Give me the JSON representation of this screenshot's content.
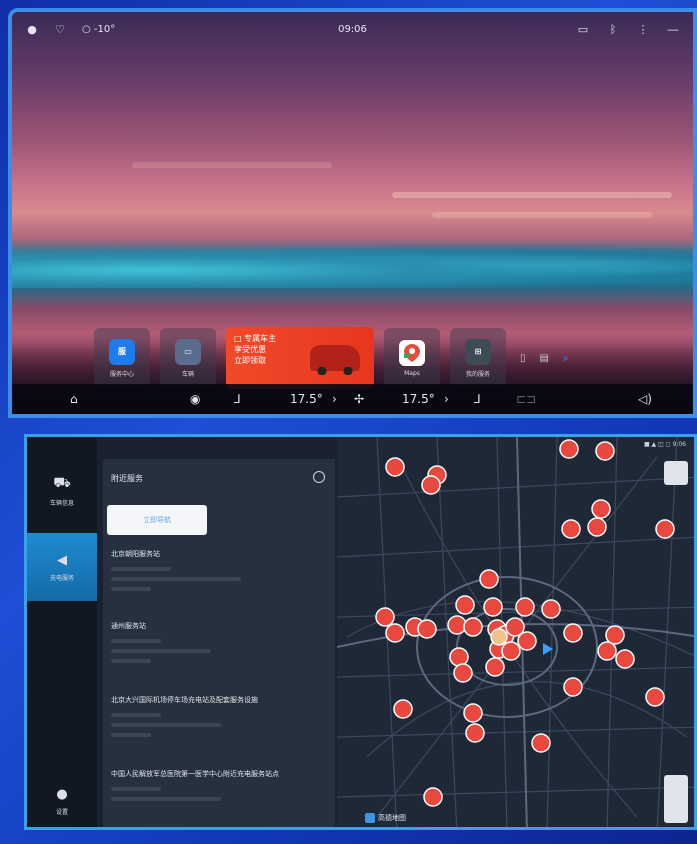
{
  "top_screen": {
    "status": {
      "temp": "○ -10°",
      "time": "09:06"
    },
    "dock": {
      "apps": [
        {
          "name": "service",
          "label": "服务中心",
          "icon_text": "服务中心",
          "color": "#1e7bea"
        },
        {
          "name": "car",
          "label": "车辆",
          "icon_text": "",
          "color": "#5b6d8e"
        }
      ],
      "promo": {
        "line1": "□ 专属车主",
        "line2": "享受优惠",
        "line3": "立即领取"
      },
      "maps": {
        "label": "Maps",
        "color": "#ffffff"
      },
      "extra": {
        "label": "我的服务"
      }
    },
    "bottom_bar": {
      "left_temp": "17.5°",
      "right_temp": "17.5°"
    }
  },
  "bottom_screen": {
    "side_nav": [
      {
        "label": "车辆信息",
        "icon": "car-icon"
      },
      {
        "label": "充电服务",
        "icon": "navigate-icon"
      },
      {
        "label": "设置",
        "icon": "settings-icon"
      }
    ],
    "panel": {
      "title": "附近服务",
      "button": "立即导航",
      "entries": [
        {
          "title": "北京朝阳服务站"
        },
        {
          "title": "通州服务站"
        },
        {
          "title": "北京大兴国际机场停车场充电站及配套服务设施"
        },
        {
          "title": "中国人民解放军总医院第一医学中心附近充电服务站点"
        }
      ]
    },
    "map": {
      "status": "■ ▲ ◫ ◻ 9:06",
      "logo": "高德地图"
    }
  }
}
